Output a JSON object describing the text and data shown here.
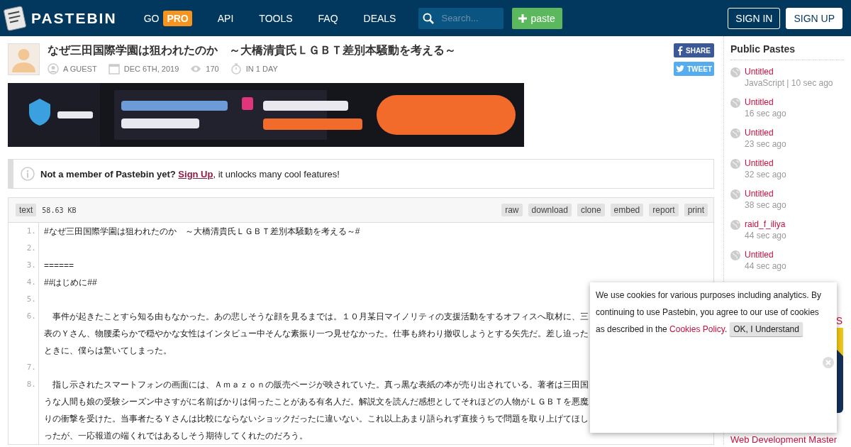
{
  "header": {
    "logo": "PASTEBIN",
    "nav": [
      {
        "label": "GO",
        "badge": "PRO"
      },
      {
        "label": "API"
      },
      {
        "label": "TOOLS"
      },
      {
        "label": "FAQ"
      },
      {
        "label": "DEALS"
      }
    ],
    "search": {
      "placeholder": "Search..."
    },
    "paste_button": "paste",
    "sign_in": "SIGN IN",
    "sign_up": "SIGN UP"
  },
  "paste": {
    "title": "なぜ三田国際学園は狙われたのか　～大橋清貴氏ＬＧＢＴ差別本騒動を考える～",
    "author": "A GUEST",
    "date": "DEC 6TH, 2019",
    "views": "170",
    "expires": "IN 1 DAY",
    "share": "SHARE",
    "tweet": "TWEET"
  },
  "notice": {
    "text": "**Not a member of Pastebin yet?** ",
    "link": "Sign Up",
    "after": ", it unlocks many cool features!"
  },
  "code": {
    "syntax": "text",
    "size": "58.63 KB",
    "actions": [
      "raw",
      "download",
      "clone",
      "embed",
      "report",
      "print"
    ],
    "lines": [
      {
        "number": "1.",
        "segments": [
          "#なぜ三田国際学園は狙われたのか　～大橋清貴氏ＬＧＢＴ差別本騒動を考える～#"
        ]
      },
      {
        "number": "2."
      },
      {
        "number": "3.",
        "segments": [
          "======"
        ]
      },
      {
        "number": "4.",
        "segments": [
          "##はじめに##"
        ]
      },
      {
        "number": "5."
      },
      {
        "number": "6.",
        "segments": [
          "　事件が起きたことすら知る由もなかった。あの悲しそうな顔を見るまでは。１０月某日マイノリティの支援活動をするオフィスへ取材に、三",
          "表のＹさん、物腰柔らかで穏やかな女性はインタビュー中そんな素振り一つ見せなかった。仕事も終わり撤収しようとする矢先だ。差し迫った",
          "ときに、僕らは驚いてしまった。"
        ]
      },
      {
        "number": "7."
      },
      {
        "number": "8.",
        "segments": [
          "　指し示されたスマートフォンの画面には、Ａｍａｚｏｎの販売ページが映されていた。真っ黒な表紙の本が売り出されている。著者は三田国",
          "うな人間も娘の受験シーズン中さすがに名前ばかりは伺ったことがある有名人だ。解説文を読んだ感想としてそれほどの人物がＬＧＢＴを悪魔",
          "りの衝撃を受けた。当事者たるＹさんは比較にならないショックだったに違いない。これ以上あまり語られず直接うちで問題を取り上げてほし",
          "ったが、一応報道の端くれではあるしそう期待してくれたのだろう。"
        ]
      }
    ]
  },
  "sidebar": {
    "title": "Public Pastes",
    "pastes": [
      {
        "title": "Untitled",
        "meta": "JavaScript | 10 sec ago"
      },
      {
        "title": "Untitled",
        "meta": "16 sec ago"
      },
      {
        "title": "Untitled",
        "meta": "23 sec ago"
      },
      {
        "title": "Untitled",
        "meta": "32 sec ago"
      },
      {
        "title": "Untitled",
        "meta": "38 sec ago"
      },
      {
        "title": "raid_f_iliya",
        "meta": "44 sec ago"
      },
      {
        "title": "Untitled",
        "meta": "44 sec ago"
      }
    ],
    "ad_heading_fragment": "S",
    "ad_link": "Web Development Master"
  },
  "cookie": {
    "text": "We use cookies for various purposes including analytics. By continuing to use Pastebin, you agree to our use of cookies",
    "text_end": "as described in the ",
    "link": "Cookies Policy",
    "after": ".",
    "button": "OK, I Understand"
  }
}
